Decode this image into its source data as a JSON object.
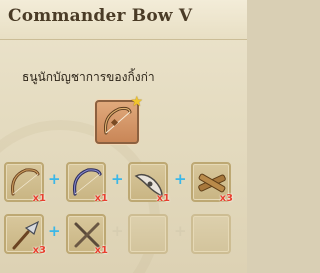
{
  "window": {
    "title": "Commander Bow V",
    "subtitle": "ธนูนักบัญชาการของกิ้งก่า"
  },
  "result": {
    "icon": "commander-bow-icon",
    "badge_icon": "star-icon",
    "badge_color": "#f2c62b"
  },
  "materials": [
    {
      "icon": "bow-icon",
      "quantity": "x1"
    },
    {
      "icon": "dark-bow-icon",
      "quantity": "x1"
    },
    {
      "icon": "boomerang-icon",
      "quantity": "x1"
    },
    {
      "icon": "crossed-sticks-icon",
      "quantity": "x3"
    },
    {
      "icon": "arrowhead-icon",
      "quantity": "x3"
    },
    {
      "icon": "crossed-rods-icon",
      "quantity": "x1"
    },
    {
      "icon": "empty-slot",
      "quantity": ""
    },
    {
      "icon": "empty-slot",
      "quantity": ""
    }
  ],
  "plus_symbol": "+",
  "colors": {
    "quantity": "#e8402e",
    "plus": "#3bb7e8",
    "result_bg": "#d99a6a"
  }
}
